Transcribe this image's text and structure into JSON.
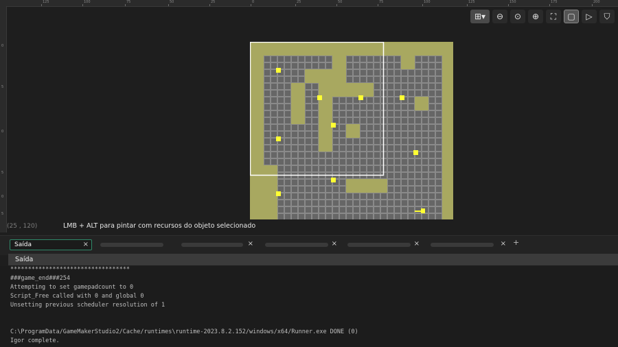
{
  "ruler": {
    "top_labels": [
      "125",
      "100",
      "75",
      "50",
      "25",
      "0",
      "25",
      "50",
      "75",
      "100",
      "125",
      "150",
      "175",
      "200"
    ],
    "left_labels": [
      "0",
      "5",
      "0",
      "5",
      "0",
      "5"
    ]
  },
  "toolbar": {
    "buttons": [
      {
        "name": "grid-toggle-button",
        "icon": "grid-icon",
        "glyph": "⊞▾"
      },
      {
        "name": "zoom-out-button",
        "icon": "zoom-out-icon",
        "glyph": "⊖"
      },
      {
        "name": "zoom-reset-button",
        "icon": "zoom-reset-icon",
        "glyph": "⊙"
      },
      {
        "name": "zoom-in-button",
        "icon": "zoom-in-icon",
        "glyph": "⊕"
      },
      {
        "name": "fit-view-button",
        "icon": "fullscreen-icon",
        "glyph": "⛶"
      },
      {
        "name": "frame-view-button",
        "icon": "frame-icon",
        "glyph": "▢"
      },
      {
        "name": "play-button",
        "icon": "play-icon",
        "glyph": "▷"
      },
      {
        "name": "paint-bucket-button",
        "icon": "bucket-icon",
        "glyph": "⛉"
      }
    ]
  },
  "status": {
    "coords": "(25 , 120)",
    "hint": "LMB + ALT para pintar com recursos do objeto selecionado"
  },
  "tabs": {
    "active_label": "Saída",
    "add_label": "+"
  },
  "output": {
    "header": "Saída",
    "lines": [
      "**********************************",
      "###game_end###254",
      "Attempting to set gamepadcount to 0",
      "Script_Free called with 0 and global 0",
      "Unsetting previous scheduler resolution of 1",
      "",
      "",
      "C:\\ProgramData/GameMakerStudio2/Cache/runtimes\\runtime-2023.8.2.152/windows/x64/Runner.exe DONE (0)",
      "Igor complete."
    ]
  },
  "colors": {
    "floor": "#a8a860",
    "wall": "#666666",
    "wall_grid": "#8a8a8a",
    "coin": "#ffff33",
    "key": "#ffff33",
    "camera_frame": "#ffffff",
    "active_tab_border": "#2f8a6a"
  }
}
